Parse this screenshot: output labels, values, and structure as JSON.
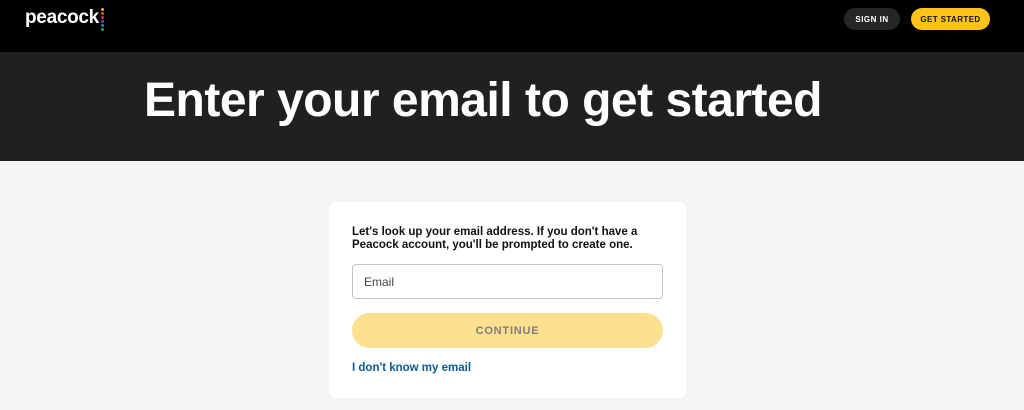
{
  "header": {
    "logo_text": "peacock",
    "logo_dot_colors": [
      "#f2b51c",
      "#e5541c",
      "#cd2a6b",
      "#7b3fa6",
      "#1f7fd1",
      "#2aa34a"
    ],
    "sign_in_label": "SIGN IN",
    "get_started_label": "GET STARTED"
  },
  "hero": {
    "title": "Enter your email to get started"
  },
  "form": {
    "description": "Let's look up your email address. If you don't have a Peacock account, you'll be prompted to create one.",
    "email_placeholder": "Email",
    "email_value": "",
    "continue_label": "CONTINUE",
    "forgot_email_link": "I don't know my email"
  },
  "colors": {
    "accent_yellow": "#fcc419",
    "continue_disabled": "#fde08f",
    "link_blue": "#0b5a91",
    "hero_bg": "#202020"
  }
}
